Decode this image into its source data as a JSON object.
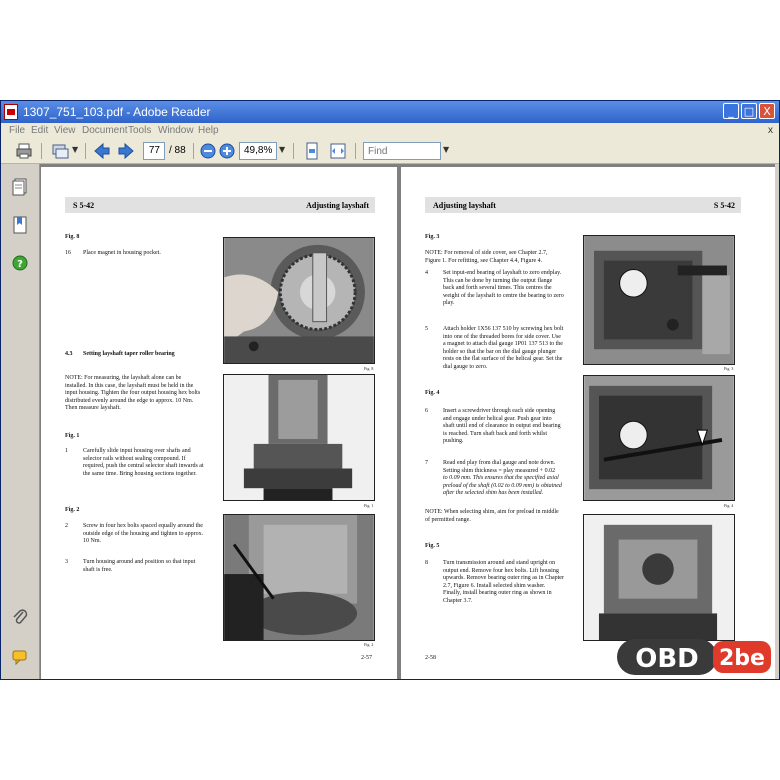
{
  "window": {
    "title": "1307_751_103.pdf - Adobe Reader",
    "buttons": {
      "minimize": "_",
      "maximize": "□",
      "close": "X"
    }
  },
  "menu": {
    "items": [
      "File",
      "Edit",
      "View",
      "Document",
      "Tools",
      "Window",
      "Help"
    ],
    "close_label": "x"
  },
  "toolbar": {
    "page_current": "77",
    "page_total": "/ 88",
    "zoom": "49,8%",
    "find_placeholder": "Find"
  },
  "sidebar": {
    "icons": [
      "pages-icon",
      "bookmarks-icon",
      "help-icon",
      "attachments-icon",
      "comments-icon"
    ]
  },
  "left_page": {
    "section": "S 5-42",
    "heading": "Adjusting layshaft",
    "fig8": "Fig. 8",
    "step16_num": "16",
    "step16_text": "Place magnet in housing pocket.",
    "sec43_num": "4.3",
    "sec43_title": "Setting layshaft taper roller bearing",
    "note_lines": [
      "NOTE: For measuring, the layshaft alone can be",
      "installed. In this case, the layshaft must be held in the",
      "input housing. Tighten the four output housing hex bolts",
      "distributed evenly around the edge to approx. 10 Nm.",
      "Then measure layshaft."
    ],
    "fig1": "Fig. 1",
    "step1_num": "1",
    "step1_lines": [
      "Carefully slide input housing over shafts and",
      "selector rails without sealing compound. If",
      "required, push the central selector shaft inwards at",
      "the same time. Bring housing sections together."
    ],
    "fig2": "Fig. 2",
    "step2_num": "2",
    "step2_lines": [
      "Screw in four hex bolts spaced equally around the",
      "outside edge of the housing and tighten to approx.",
      "10 Nm."
    ],
    "step3_num": "3",
    "step3_lines": [
      "Turn housing around and position so that input",
      "shaft is free."
    ],
    "page_number": "2-57"
  },
  "right_page": {
    "section": "S 5-42",
    "heading": "Adjusting layshaft",
    "fig3": "Fig. 3",
    "note1_lines": [
      "NOTE: For removal of side cover, see Chapter 2.7,",
      "Figure 1. For refitting, see Chapter 4.4, Figure 4."
    ],
    "step4_num": "4",
    "step4_lines": [
      "Set input-end bearing of layshaft to zero endplay.",
      "This can be done by turning the output flange",
      "back and forth several times. This centres the",
      "weight of the layshaft to centre the bearing to zero",
      "play."
    ],
    "step5_num": "5",
    "step5_lines": [
      "Attach holder 1X56 137 510 by screwing hex bolt",
      "into one of the threaded bores for side cover. Use",
      "a magnet to attach dial gauge 1P01 137 513 to the",
      "holder so that the bar on the dial gauge plunger",
      "rests on the flat surface of the helical gear. Set the",
      "dial gauge to zero."
    ],
    "fig4": "Fig. 4",
    "step6_num": "6",
    "step6_lines": [
      "Insert a screwdriver through each side opening",
      "and engage under helical gear. Push gear into",
      "shaft until end of clearance in output end bearing",
      "is reached. Turn shaft back and forth whilst",
      "pushing."
    ],
    "step7_num": "7",
    "step7_lines": [
      "Read end play from dial gauge and note down.",
      "Setting shim thickness = play measured + 0.02",
      "to 0.09 mm. This ensures that the specified axial",
      "preload of the shaft (0.02 to 0.09 mm) is obtained",
      "after the selected shim has been installed."
    ],
    "note2_lines": [
      "NOTE: When selecting shim, aim for preload in middle",
      "of permitted range."
    ],
    "fig5": "Fig. 5",
    "step8_num": "8",
    "step8_lines": [
      "Turn transmission around and stand upright on",
      "output end. Remove four hex bolts. Lift housing",
      "upwards. Remove bearing outer ring as in Chapter",
      "2.7, Figure 6. Install selected shim washer.",
      "Finally, install bearing outer ring as shown in",
      "Chapter 3.7."
    ],
    "page_number": "2-58"
  },
  "figure_captions": [
    "Fig. 8",
    "Fig. 1",
    "Fig. 2",
    "Fig. 3",
    "Fig. 4",
    "Fig. 5"
  ],
  "watermark": {
    "text1": "OBD",
    "text2": "2be"
  },
  "colors": {
    "titlebar": "#2f63c9",
    "accent_red": "#e03a2a",
    "watermark_grey": "#3a3a3a"
  }
}
